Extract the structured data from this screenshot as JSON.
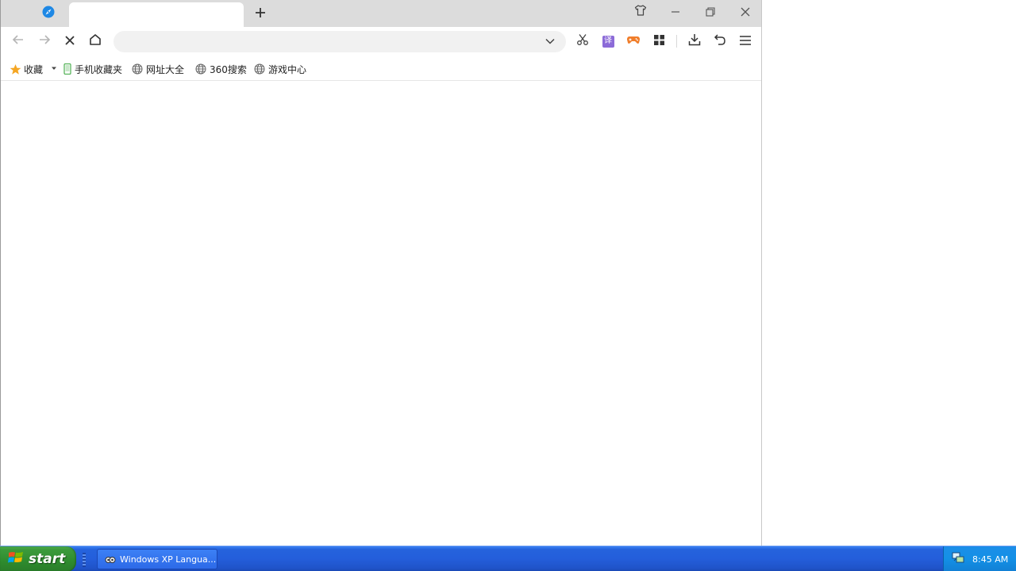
{
  "browser": {
    "tabs": [
      {
        "label": "",
        "icon": "compass-icon",
        "active": false
      },
      {
        "label": "",
        "active": true
      }
    ],
    "new_tab_icon": "plus-icon",
    "window_controls": [
      "skin-icon",
      "minimize-icon",
      "restore-icon",
      "close-icon"
    ],
    "toolbar": {
      "back_icon": "arrow-left-icon",
      "forward_icon": "arrow-right-icon",
      "stop_icon": "close-icon",
      "home_icon": "home-icon",
      "address_value": "",
      "address_placeholder": "",
      "right_icons": [
        "scissors-icon",
        "translate-icon",
        "gamepad-icon",
        "apps-icon",
        "download-icon",
        "undo-icon",
        "menu-icon"
      ],
      "translate_glyph": "译"
    },
    "bookmarks": [
      {
        "label": "收藏",
        "icon": "star-icon",
        "has_dropdown": true
      },
      {
        "label": "手机收藏夹",
        "icon": "phone-icon"
      },
      {
        "label": "网址大全",
        "icon": "globe-icon"
      },
      {
        "label": "360搜索",
        "icon": "globe-icon"
      },
      {
        "label": "游戏中心",
        "icon": "globe-icon"
      }
    ],
    "colors": {
      "titlebar": "#dcdcdc",
      "accent_blue": "#1e88e5",
      "translate_purple": "#8c6bd8",
      "game_orange": "#f07d2a",
      "star_orange": "#f5a623"
    }
  },
  "taskbar": {
    "start_label": "start",
    "tasks": [
      {
        "label": "Windows XP Langua...",
        "icon": "language-bar-icon"
      }
    ],
    "tray": {
      "icon": "network-icon",
      "time": "8:45 AM"
    }
  }
}
